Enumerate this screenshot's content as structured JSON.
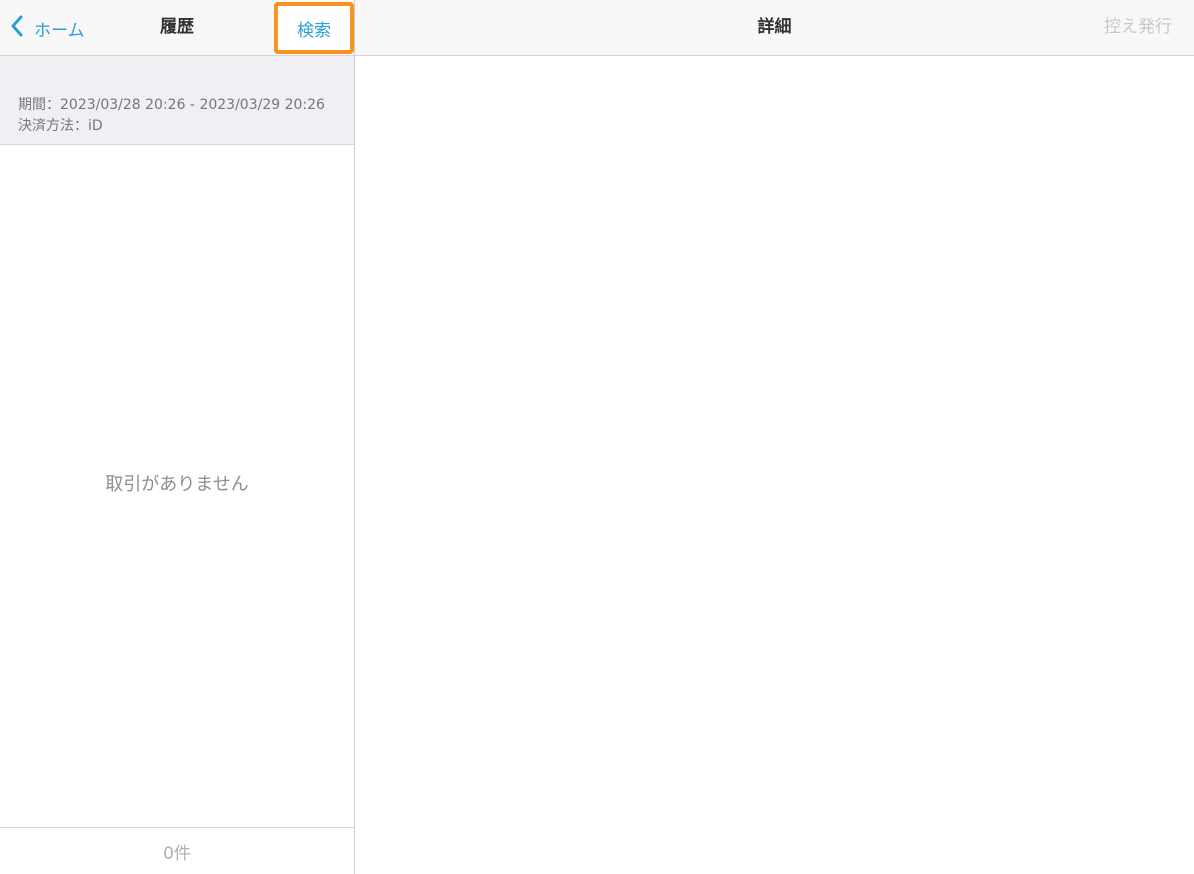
{
  "master": {
    "nav": {
      "back_label": "ホーム",
      "title": "履歴",
      "search_label": "検索"
    },
    "filter": {
      "period": "期間：2023/03/28 20:26 - 2023/03/29 20:26",
      "payment_method": "決済方法：iD"
    },
    "empty_message": "取引がありません",
    "footer": {
      "count": "0件"
    }
  },
  "detail": {
    "nav": {
      "title": "詳細",
      "issue_copy_label": "控え発行",
      "issue_copy_enabled": false
    }
  },
  "colors": {
    "accent": "#2a9fd8",
    "highlight": "#f7931e",
    "disabled": "#c8c8c8"
  },
  "icons": {
    "back": "chevron-left-icon"
  }
}
